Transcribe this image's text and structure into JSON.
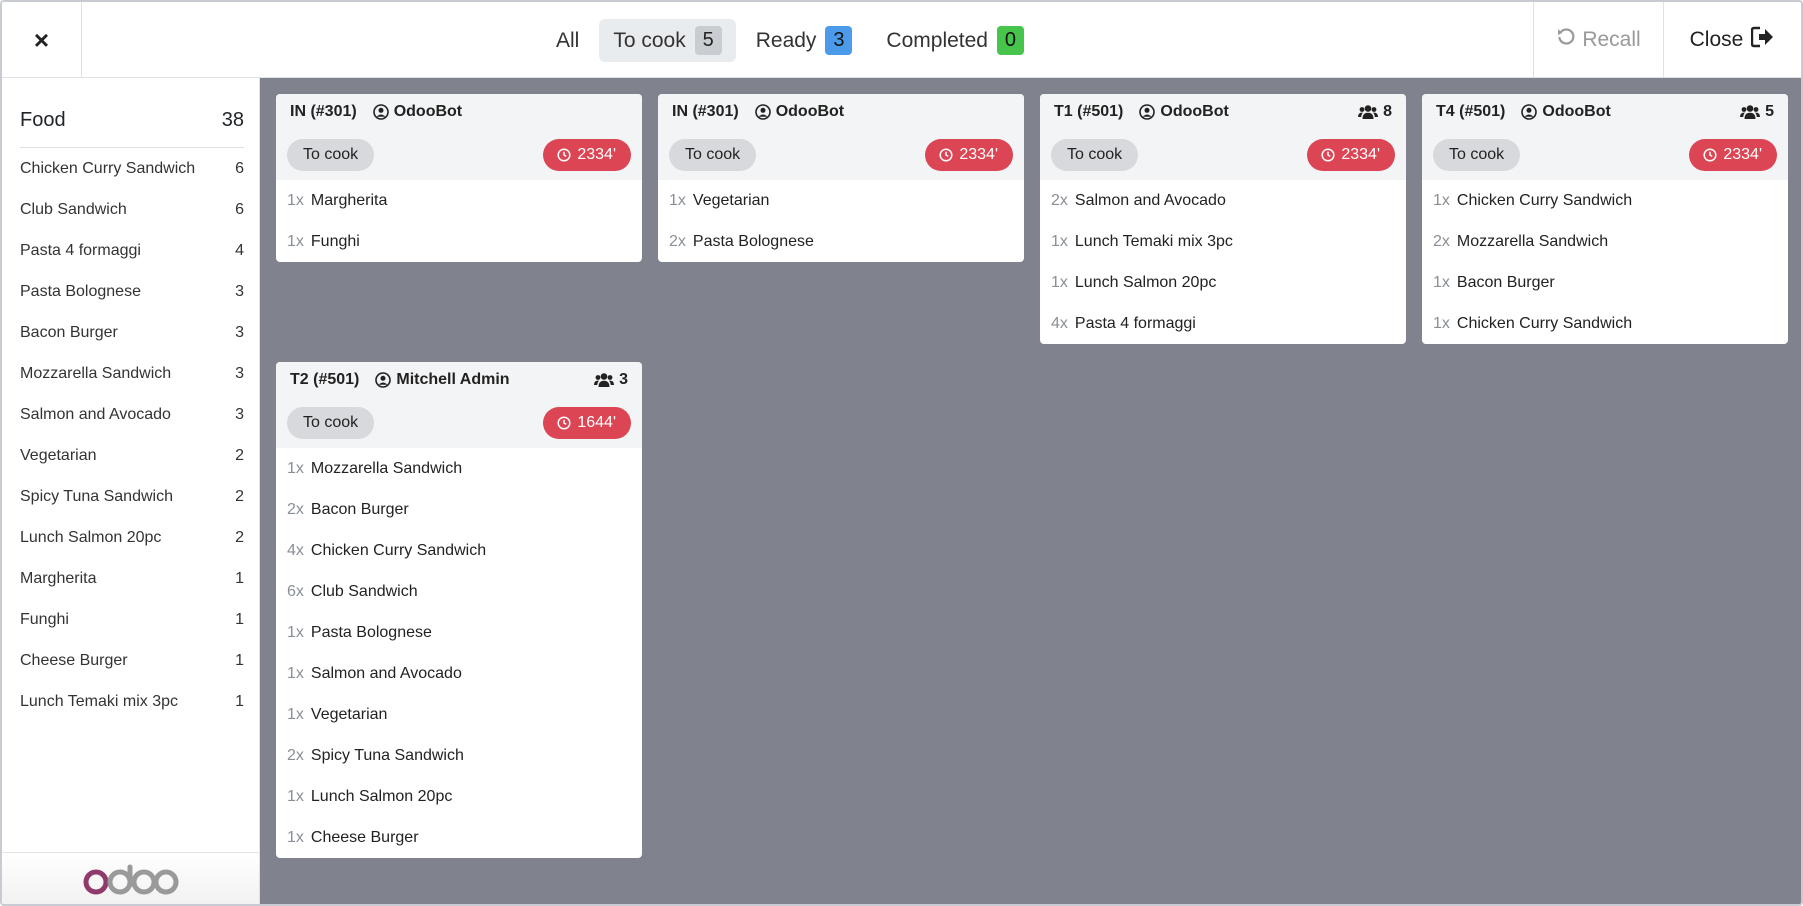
{
  "topbar": {
    "close_icon": "×",
    "tabs": [
      {
        "label": "All",
        "count": null
      },
      {
        "label": "To cook",
        "count": "5"
      },
      {
        "label": "Ready",
        "count": "3"
      },
      {
        "label": "Completed",
        "count": "0"
      }
    ],
    "recall_label": "Recall",
    "close_label": "Close"
  },
  "sidebar": {
    "category": {
      "name": "Food",
      "count": "38"
    },
    "items": [
      {
        "name": "Chicken Curry Sandwich",
        "count": "6"
      },
      {
        "name": "Club Sandwich",
        "count": "6"
      },
      {
        "name": "Pasta 4 formaggi",
        "count": "4"
      },
      {
        "name": "Pasta Bolognese",
        "count": "3"
      },
      {
        "name": "Bacon Burger",
        "count": "3"
      },
      {
        "name": "Mozzarella Sandwich",
        "count": "3"
      },
      {
        "name": "Salmon and Avocado",
        "count": "3"
      },
      {
        "name": "Vegetarian",
        "count": "2"
      },
      {
        "name": "Spicy Tuna Sandwich",
        "count": "2"
      },
      {
        "name": "Lunch Salmon 20pc",
        "count": "2"
      },
      {
        "name": "Margherita",
        "count": "1"
      },
      {
        "name": "Funghi",
        "count": "1"
      },
      {
        "name": "Cheese Burger",
        "count": "1"
      },
      {
        "name": "Lunch Temaki mix 3pc",
        "count": "1"
      }
    ],
    "logo_text": "odoo"
  },
  "orders": [
    {
      "ref": "IN (#301)",
      "user": "OdooBot",
      "guests": null,
      "state": "To cook",
      "time": "2334'",
      "lines": [
        {
          "qty": "1x",
          "name": "Margherita"
        },
        {
          "qty": "1x",
          "name": "Funghi"
        }
      ]
    },
    {
      "ref": "IN (#301)",
      "user": "OdooBot",
      "guests": null,
      "state": "To cook",
      "time": "2334'",
      "lines": [
        {
          "qty": "1x",
          "name": "Vegetarian"
        },
        {
          "qty": "2x",
          "name": "Pasta Bolognese"
        }
      ]
    },
    {
      "ref": "T1 (#501)",
      "user": "OdooBot",
      "guests": "8",
      "state": "To cook",
      "time": "2334'",
      "lines": [
        {
          "qty": "2x",
          "name": "Salmon and Avocado"
        },
        {
          "qty": "1x",
          "name": "Lunch Temaki mix 3pc"
        },
        {
          "qty": "1x",
          "name": "Lunch Salmon 20pc"
        },
        {
          "qty": "4x",
          "name": "Pasta 4 formaggi"
        }
      ]
    },
    {
      "ref": "T4 (#501)",
      "user": "OdooBot",
      "guests": "5",
      "state": "To cook",
      "time": "2334'",
      "lines": [
        {
          "qty": "1x",
          "name": "Chicken Curry Sandwich"
        },
        {
          "qty": "2x",
          "name": "Mozzarella Sandwich"
        },
        {
          "qty": "1x",
          "name": "Bacon Burger"
        },
        {
          "qty": "1x",
          "name": "Chicken Curry Sandwich"
        }
      ]
    },
    {
      "ref": "T2 (#501)",
      "user": "Mitchell Admin",
      "guests": "3",
      "state": "To cook",
      "time": "1644'",
      "lines": [
        {
          "qty": "1x",
          "name": "Mozzarella Sandwich"
        },
        {
          "qty": "2x",
          "name": "Bacon Burger"
        },
        {
          "qty": "4x",
          "name": "Chicken Curry Sandwich"
        },
        {
          "qty": "6x",
          "name": "Club Sandwich"
        },
        {
          "qty": "1x",
          "name": "Pasta Bolognese"
        },
        {
          "qty": "1x",
          "name": "Salmon and Avocado"
        },
        {
          "qty": "1x",
          "name": "Vegetarian"
        },
        {
          "qty": "2x",
          "name": "Spicy Tuna Sandwich"
        },
        {
          "qty": "1x",
          "name": "Lunch Salmon 20pc"
        },
        {
          "qty": "1x",
          "name": "Cheese Burger"
        }
      ]
    }
  ],
  "colors": {
    "accent_red": "#dc4554",
    "board_bg": "#80828e",
    "badge_blue": "#4c9bea",
    "badge_green": "#47c44b"
  }
}
